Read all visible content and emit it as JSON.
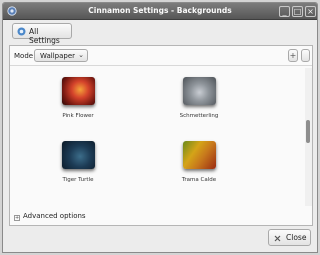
{
  "window": {
    "title": "Cinnamon Settings - Backgrounds",
    "controls": {
      "minimize": "_",
      "maximize": "□",
      "close": "×"
    }
  },
  "toolbar": {
    "all_settings_label": "All Settings"
  },
  "mode": {
    "label": "Mode",
    "selected": "Wallpaper",
    "chevron": "⌄"
  },
  "list_actions": {
    "add": "+"
  },
  "wallpapers": [
    {
      "name": "Pink Flower"
    },
    {
      "name": "Schmetterling"
    },
    {
      "name": "Tiger Turtle"
    },
    {
      "name": "Trama Calde"
    }
  ],
  "advanced": {
    "expander": "+",
    "label": "Advanced options"
  },
  "footer": {
    "close_label": "Close"
  },
  "icons": {
    "app": "cinnamon-app-icon",
    "all_settings": "settings-icon",
    "close": "close-icon"
  }
}
